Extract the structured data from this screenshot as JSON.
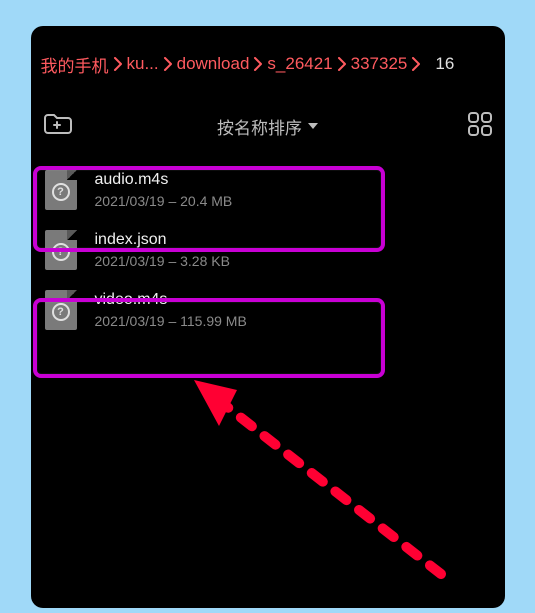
{
  "breadcrumb": {
    "items": [
      {
        "label": "我的手机"
      },
      {
        "label": "ku..."
      },
      {
        "label": "download"
      },
      {
        "label": "s_26421"
      },
      {
        "label": "337325"
      }
    ],
    "current": "16"
  },
  "toolbar": {
    "new_folder_icon": "new-folder-icon",
    "sort_label": "按名称排序",
    "grid_icon": "grid-view-icon"
  },
  "files": [
    {
      "name": "audio.m4s",
      "meta": "2021/03/19 – 20.4 MB",
      "highlighted": true
    },
    {
      "name": "index.json",
      "meta": "2021/03/19 – 3.28 KB",
      "highlighted": false
    },
    {
      "name": "video.m4s",
      "meta": "2021/03/19 – 115.99 MB",
      "highlighted": true
    }
  ],
  "annotation": {
    "highlight_color": "#c800d4",
    "arrow_color": "#ff0033"
  }
}
